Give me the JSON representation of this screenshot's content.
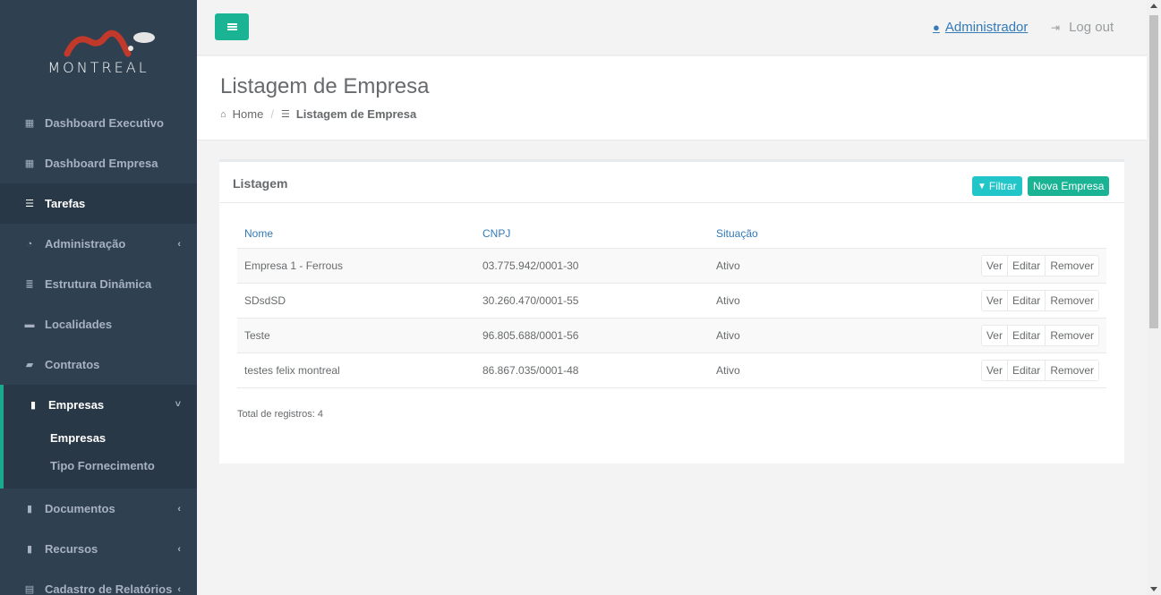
{
  "brand": {
    "name": "MONTREAL"
  },
  "sidebar": {
    "items": [
      {
        "label": "Dashboard Executivo",
        "icon": "th-large-icon"
      },
      {
        "label": "Dashboard Empresa",
        "icon": "th-large-icon"
      },
      {
        "label": "Tarefas",
        "icon": "tasks-icon"
      },
      {
        "label": "Administração",
        "icon": "dashboard-icon"
      },
      {
        "label": "Estrutura Dinâmica",
        "icon": "database-icon"
      },
      {
        "label": "Localidades",
        "icon": "briefcase-icon"
      },
      {
        "label": "Contratos",
        "icon": "book-icon"
      },
      {
        "label": "Empresas",
        "icon": "file-icon"
      },
      {
        "label": "Documentos",
        "icon": "file-icon"
      },
      {
        "label": "Recursos",
        "icon": "file-icon"
      },
      {
        "label": "Cadastro de Relatórios",
        "icon": "list-alt-icon"
      }
    ],
    "sub_items": [
      {
        "label": "Empresas"
      },
      {
        "label": "Tipo Fornecimento"
      }
    ]
  },
  "topbar": {
    "user": "Administrador",
    "logout": "Log out"
  },
  "heading": {
    "title": "Listagem de Empresa",
    "breadcrumb_home": "Home",
    "breadcrumb_current": "Listagem de Empresa"
  },
  "panel": {
    "title": "Listagem",
    "filter_label": "Filtrar",
    "new_label": "Nova Empresa",
    "columns": [
      "Nome",
      "CNPJ",
      "Situação"
    ],
    "rows": [
      {
        "nome": "Empresa 1 - Ferrous",
        "cnpj": "03.775.942/0001-30",
        "situacao": "Ativo"
      },
      {
        "nome": "SDsdSD",
        "cnpj": "30.260.470/0001-55",
        "situacao": "Ativo"
      },
      {
        "nome": "Teste",
        "cnpj": "96.805.688/0001-56",
        "situacao": "Ativo"
      },
      {
        "nome": "testes felix montreal",
        "cnpj": "86.867.035/0001-48",
        "situacao": "Ativo"
      }
    ],
    "actions": {
      "view": "Ver",
      "edit": "Editar",
      "remove": "Remover"
    },
    "total": "Total de registros: 4"
  },
  "colors": {
    "sidebar": "#2f4050",
    "accent": "#1ab394",
    "filter": "#23c6c8",
    "link": "#337ab7"
  }
}
